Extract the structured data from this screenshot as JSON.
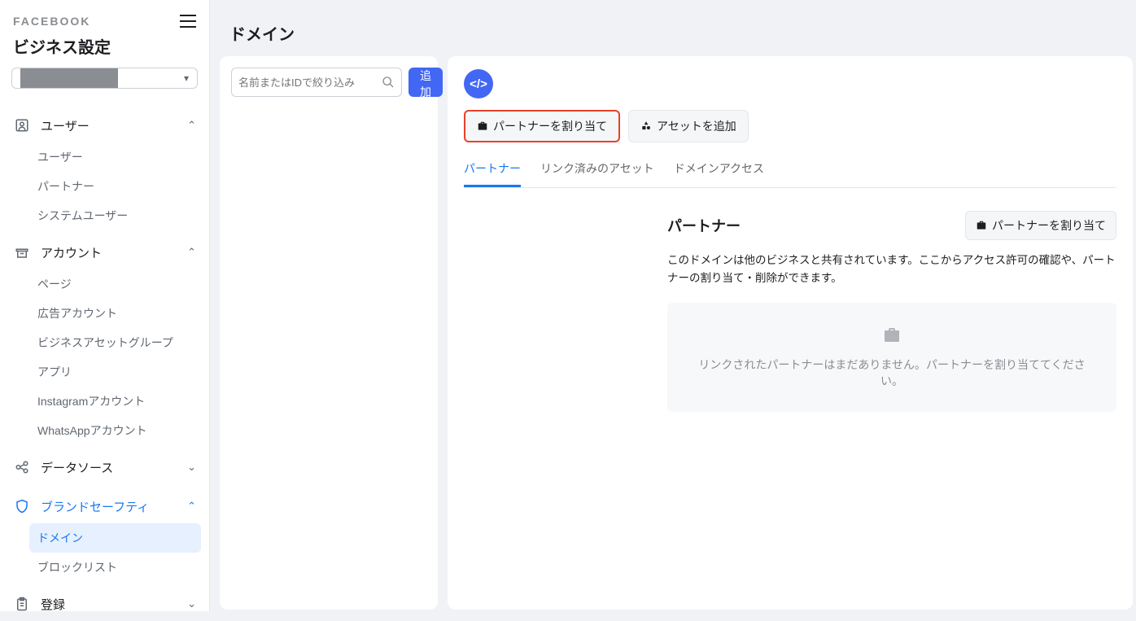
{
  "brand": "FACEBOOK",
  "page_title": "ビジネス設定",
  "sidebar": {
    "sections": [
      {
        "title": "ユーザー",
        "expanded": true,
        "items": [
          "ユーザー",
          "パートナー",
          "システムユーザー"
        ]
      },
      {
        "title": "アカウント",
        "expanded": true,
        "items": [
          "ページ",
          "広告アカウント",
          "ビジネスアセットグループ",
          "アプリ",
          "Instagramアカウント",
          "WhatsAppアカウント"
        ]
      },
      {
        "title": "データソース",
        "expanded": false,
        "items": []
      },
      {
        "title": "ブランドセーフティ",
        "expanded": true,
        "active": true,
        "items": [
          "ドメイン",
          "ブロックリスト"
        ],
        "active_item": "ドメイン"
      },
      {
        "title": "登録",
        "expanded": false,
        "items": []
      }
    ]
  },
  "main_header": "ドメイン",
  "search_placeholder": "名前またはIDで絞り込み",
  "add_button": "追加",
  "action_buttons": {
    "assign_partner": "パートナーを割り当て",
    "add_asset": "アセットを追加"
  },
  "tabs": [
    "パートナー",
    "リンク済みのアセット",
    "ドメインアクセス"
  ],
  "active_tab": "パートナー",
  "partner_panel": {
    "title": "パートナー",
    "assign_button": "パートナーを割り当て",
    "description": "このドメインは他のビジネスと共有されています。ここからアクセス許可の確認や、パートナーの割り当て・削除ができます。",
    "empty_message": "リンクされたパートナーはまだありません。パートナーを割り当ててください。"
  }
}
